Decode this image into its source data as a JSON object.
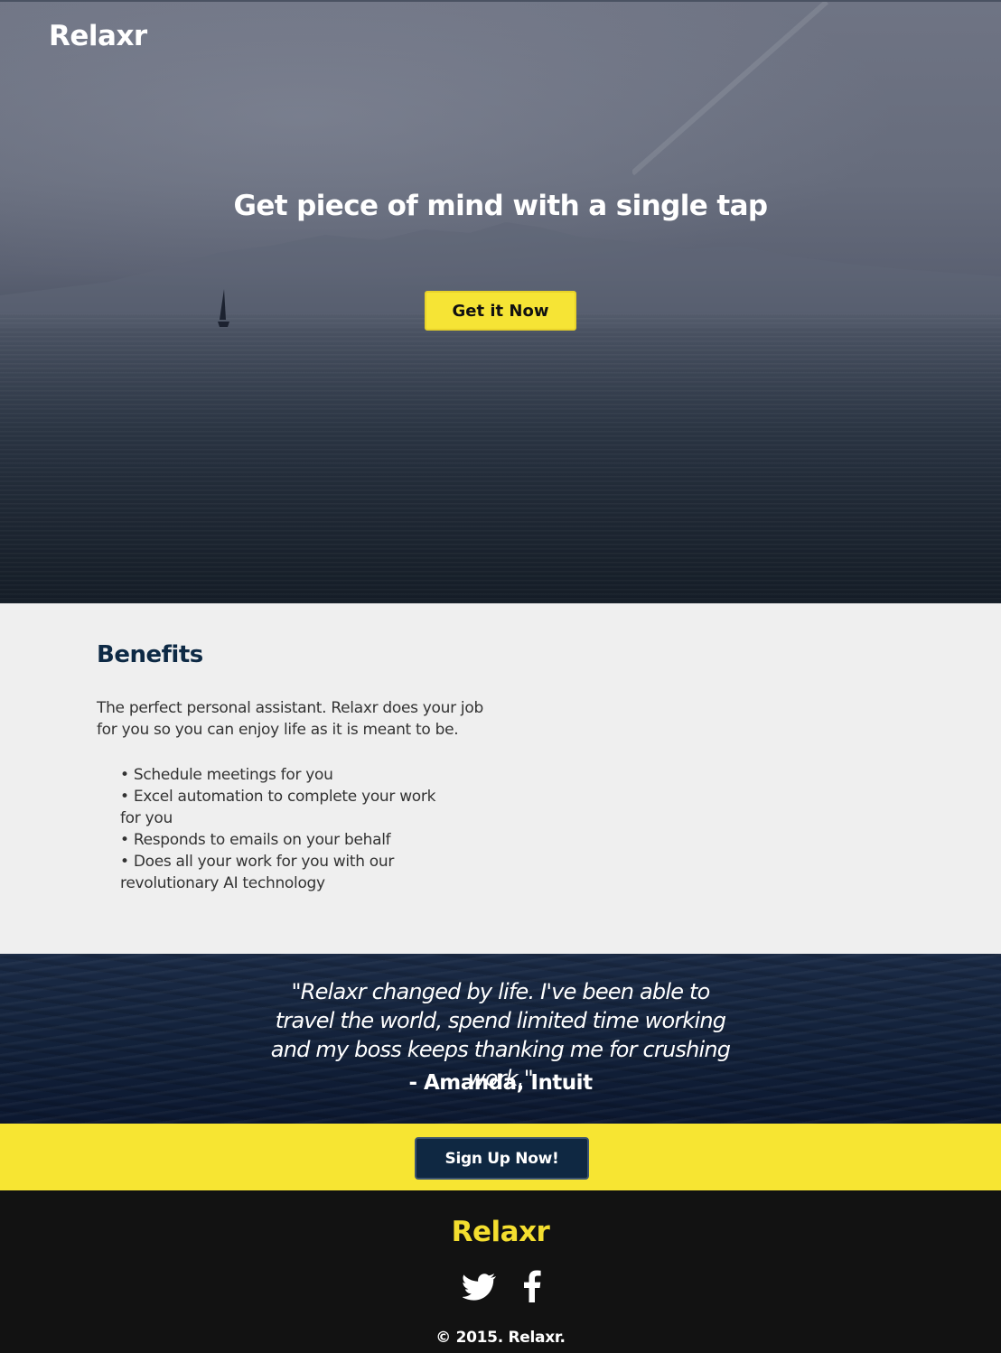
{
  "hero": {
    "logo": "Relaxr",
    "headline": "Get piece of mind with a single tap",
    "cta_label": "Get it Now"
  },
  "benefits": {
    "title": "Benefits",
    "intro": "The perfect personal assistant. Relaxr does your job for you so you can enjoy life as it is meant to be.",
    "items": [
      "Schedule meetings for you",
      "Excel automation to complete your work for you",
      "Responds to emails on your behalf",
      "Does all your work for you with our revolutionary AI technology"
    ]
  },
  "testimonial": {
    "quote": "\"Relaxr changed by life. I've been able to travel the world, spend limited time working and my boss keeps thanking me for crushing work.\"",
    "author": "- Amanda, Intuit"
  },
  "signup": {
    "button_label": "Sign Up Now!"
  },
  "footer": {
    "logo": "Relaxr",
    "social_icons": [
      "twitter-icon",
      "facebook-icon"
    ],
    "copyright": "© 2015. Relaxr."
  },
  "colors": {
    "accent_yellow": "#f6e435",
    "navy": "#0f2842",
    "footer_bg": "#121212",
    "benefits_bg": "#efefef",
    "footer_logo": "#f4de2f"
  }
}
